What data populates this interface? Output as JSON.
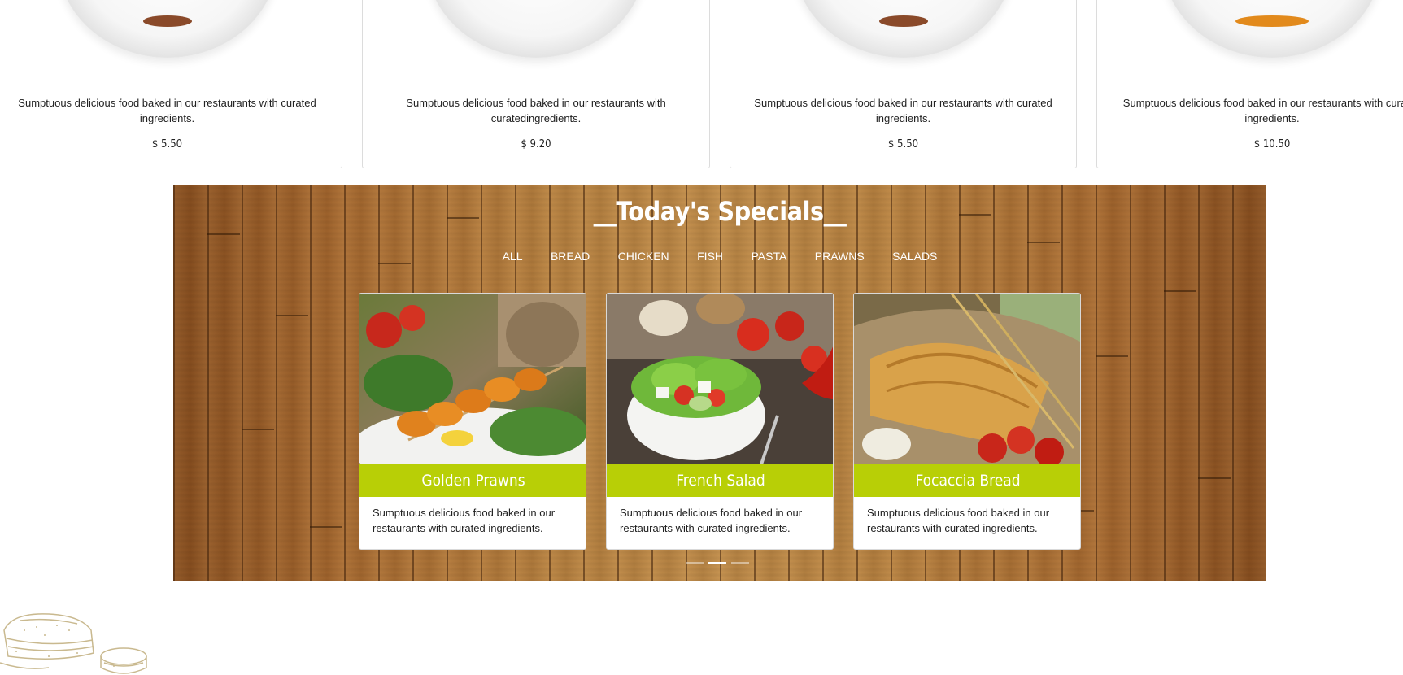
{
  "menu_items": [
    {
      "description": "Sumptuous delicious food baked in our restaurants with curated ingredients.",
      "price": "$ 5.50"
    },
    {
      "description": "Sumptuous delicious food baked in our restaurants with curatedingredients.",
      "price": "$ 9.20"
    },
    {
      "description": "Sumptuous delicious food baked in our restaurants with curated ingredients.",
      "price": "$ 5.50"
    },
    {
      "description": "Sumptuous delicious food baked in our restaurants with curated ingredients.",
      "price": "$ 10.50"
    }
  ],
  "specials": {
    "title": "__Today's Specials__",
    "filters": [
      "ALL",
      "BREAD",
      "CHICKEN",
      "FISH",
      "PASTA",
      "PRAWNS",
      "SALADS"
    ],
    "items": [
      {
        "name": "Golden Prawns",
        "description": "Sumptuous delicious food baked in our restaurants with curated ingredients."
      },
      {
        "name": "French Salad",
        "description": "Sumptuous delicious food baked in our restaurants with curated ingredients."
      },
      {
        "name": "Focaccia Bread",
        "description": "Sumptuous delicious food baked in our restaurants with curated ingredients."
      }
    ],
    "carousel": {
      "pages": 3,
      "active_index": 1
    }
  },
  "colors": {
    "accent_green": "#b8cf06",
    "wood_brown": "#9a5f2a",
    "sketch_beige": "#c9b98f"
  }
}
